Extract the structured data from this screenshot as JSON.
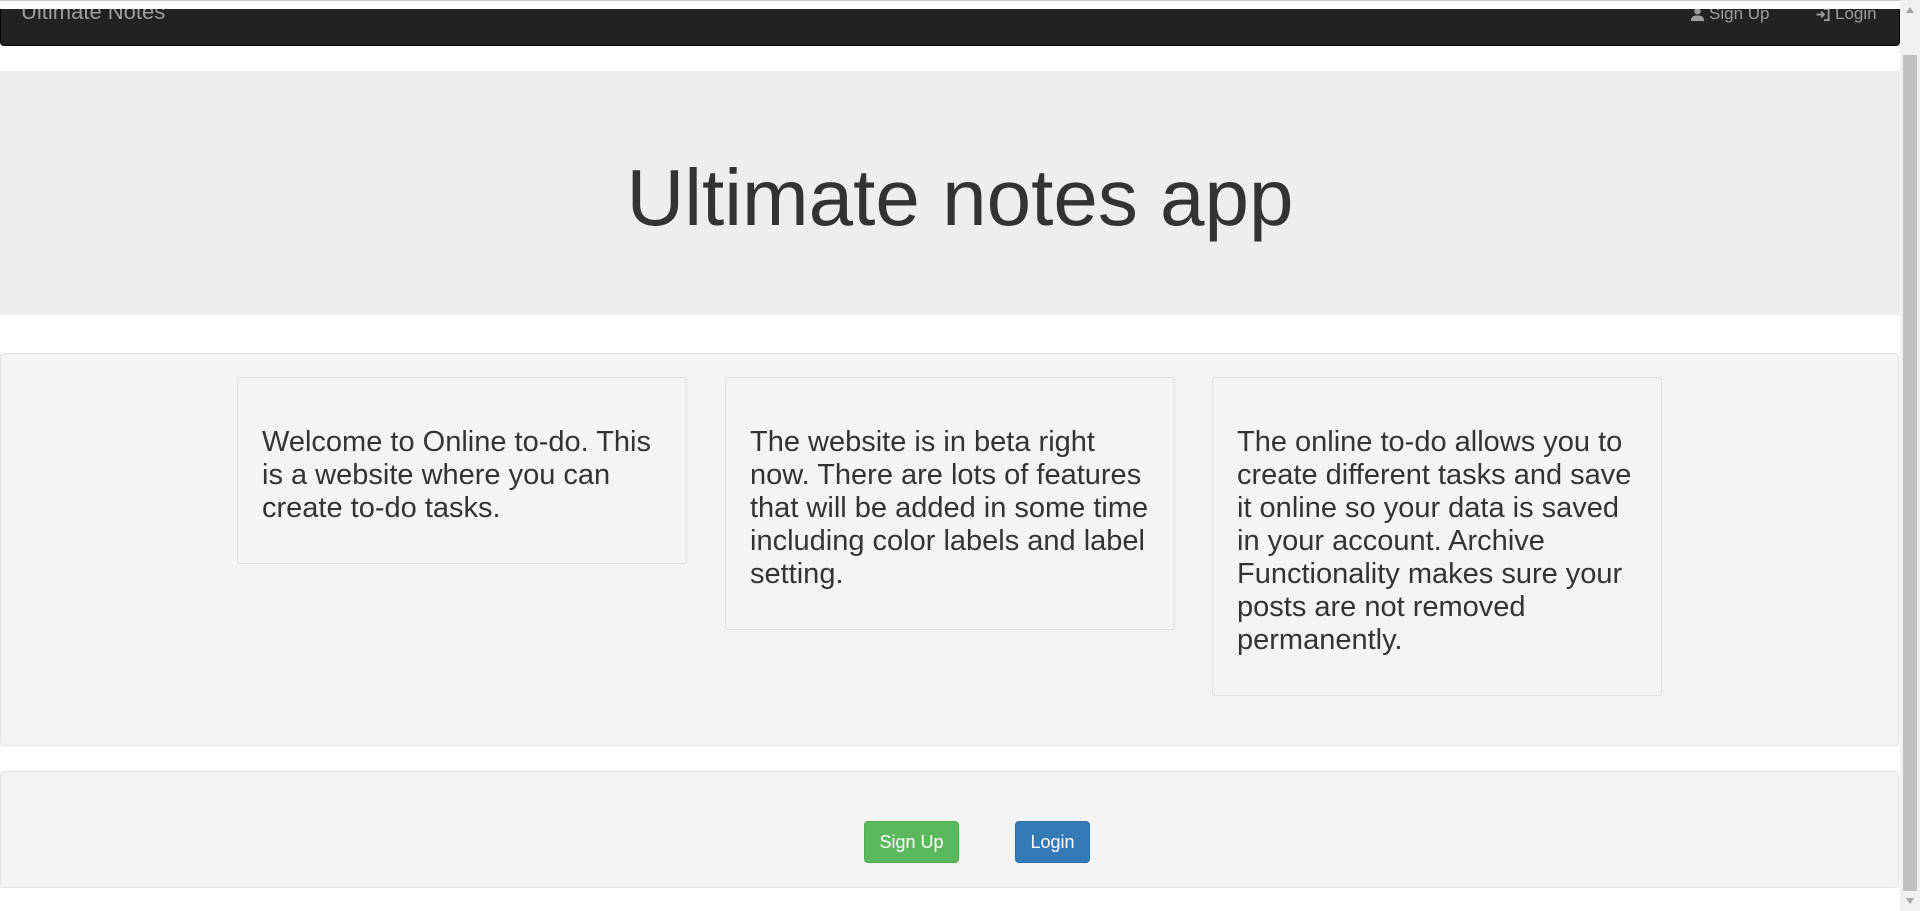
{
  "navbar": {
    "brand": "Ultimate Notes",
    "signup_label": "Sign Up",
    "login_label": "Login"
  },
  "hero": {
    "title": "Ultimate notes app"
  },
  "features": [
    {
      "text": "Welcome to Online to-do. This is a website where you can create to-do tasks."
    },
    {
      "text": "The website is in beta right now. There are lots of features that will be added in some time including color labels and label setting."
    },
    {
      "text": "The online to-do allows you to create different tasks and save it online so your data is saved in your account. Archive Functionality makes sure your posts are not removed permanently."
    }
  ],
  "actions": {
    "signup_label": "Sign Up",
    "login_label": "Login"
  },
  "colors": {
    "navbar_bg": "#222222",
    "jumbotron_bg": "#eeeeee",
    "well_bg": "#f4f4f4",
    "signup_button": "#5cb85c",
    "login_button": "#337ab7"
  },
  "icons": {
    "signup": "user-icon",
    "login": "log-in-icon",
    "scroll_up": "arrow-up-icon",
    "scroll_down": "arrow-down-icon"
  }
}
